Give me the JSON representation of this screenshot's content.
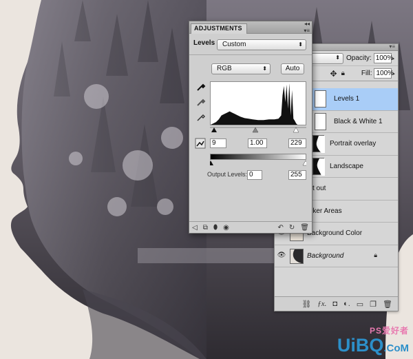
{
  "adjustments": {
    "tab": "ADJUSTMENTS",
    "heading": "Levels",
    "preset": "Custom",
    "channel": "RGB",
    "auto_label": "Auto",
    "input_levels": [
      "9",
      "1.00",
      "229"
    ],
    "output_label": "Output Levels:",
    "output_levels": [
      "0",
      "255"
    ],
    "icons": [
      "eyedropper-black-icon",
      "eyedropper-gray-icon",
      "eyedropper-white-icon",
      "on-image-adjust-icon",
      "return-icon",
      "clip-to-layer-icon",
      "visibility-icon",
      "view-previous-icon",
      "reset-icon",
      "delete-icon"
    ]
  },
  "layers": {
    "opacity_label": "Opacity:",
    "opacity_value": "100%",
    "fill_label": "Fill:",
    "fill_value": "100%",
    "items": [
      {
        "name": "Levels 1",
        "selected": true
      },
      {
        "name": "Black & White 1"
      },
      {
        "name": "Portrait overlay"
      },
      {
        "name": "Landscape"
      },
      {
        "name": "t out"
      },
      {
        "name": "rker Areas"
      },
      {
        "name": "Background Color"
      },
      {
        "name": "Background",
        "locked": true
      }
    ],
    "footer_icons": [
      "link-icon",
      "fx-icon",
      "mask-icon",
      "adjustment-icon",
      "group-icon",
      "new-layer-icon",
      "trash-icon"
    ]
  },
  "watermark": {
    "top": "PS爱好者",
    "main": "UiBQ",
    "suffix": ".CoM"
  }
}
